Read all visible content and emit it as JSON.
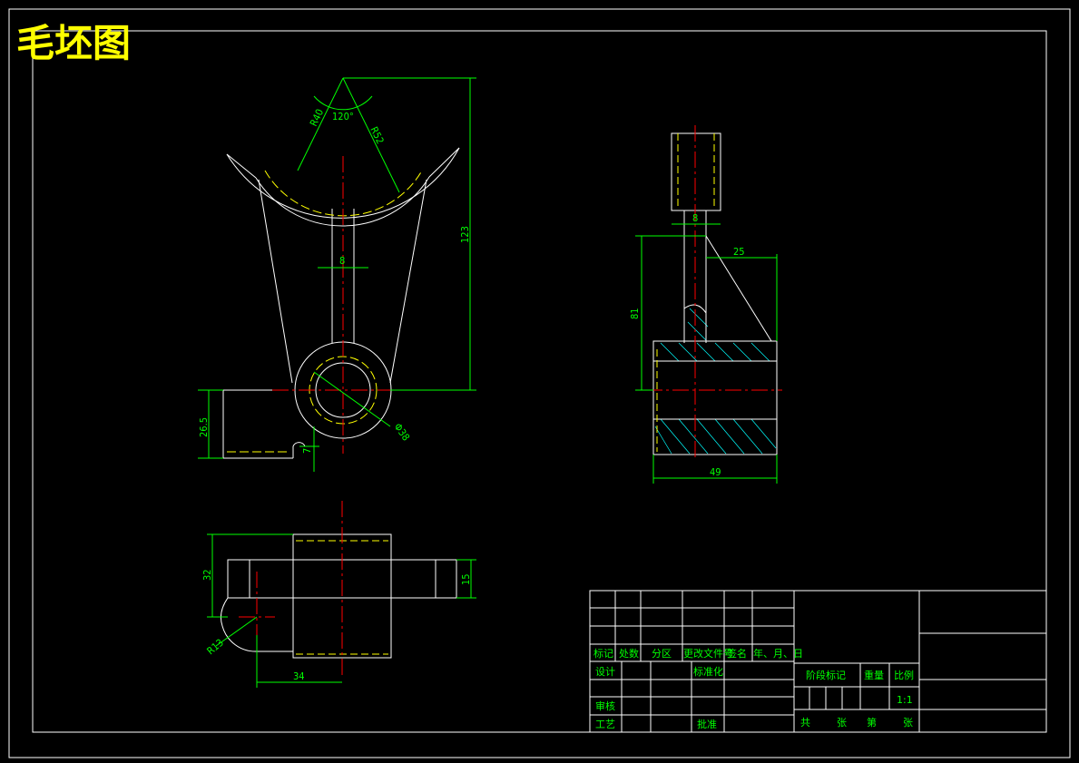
{
  "title": "毛坯图",
  "colors": {
    "background": "#000000",
    "outline": "#ffffff",
    "dimension": "#00ff00",
    "centerline": "#ff0000",
    "hidden": "#ffff00",
    "hatch": "#00ffff",
    "title": "#ffff00"
  },
  "front_view": {
    "dims": {
      "angle": "120°",
      "r_inner": "R40",
      "r_outer": "R52",
      "height_total": "123",
      "web_width": "8",
      "hub_dia": "Φ38",
      "lug_height": "26.5",
      "lug_offset": "7"
    }
  },
  "side_view": {
    "dims": {
      "stem_width": "8",
      "top_width": "25",
      "height": "81",
      "bottom_width": "49"
    }
  },
  "top_view": {
    "dims": {
      "total_height": "32",
      "flange_height": "15",
      "radius": "R13",
      "offset": "34"
    }
  },
  "title_block": {
    "header_row": [
      "标记",
      "处数",
      "分区",
      "更改文件号",
      "签名",
      "年、月、日"
    ],
    "design": "设计",
    "standardize": "标准化",
    "review": "审核",
    "process": "工艺",
    "approve": "批准",
    "stage_mark": "阶段标记",
    "weight": "重量",
    "ratio": "比例",
    "ratio_value": "1:1",
    "sheets": [
      "共",
      "张",
      "第",
      "张"
    ]
  }
}
